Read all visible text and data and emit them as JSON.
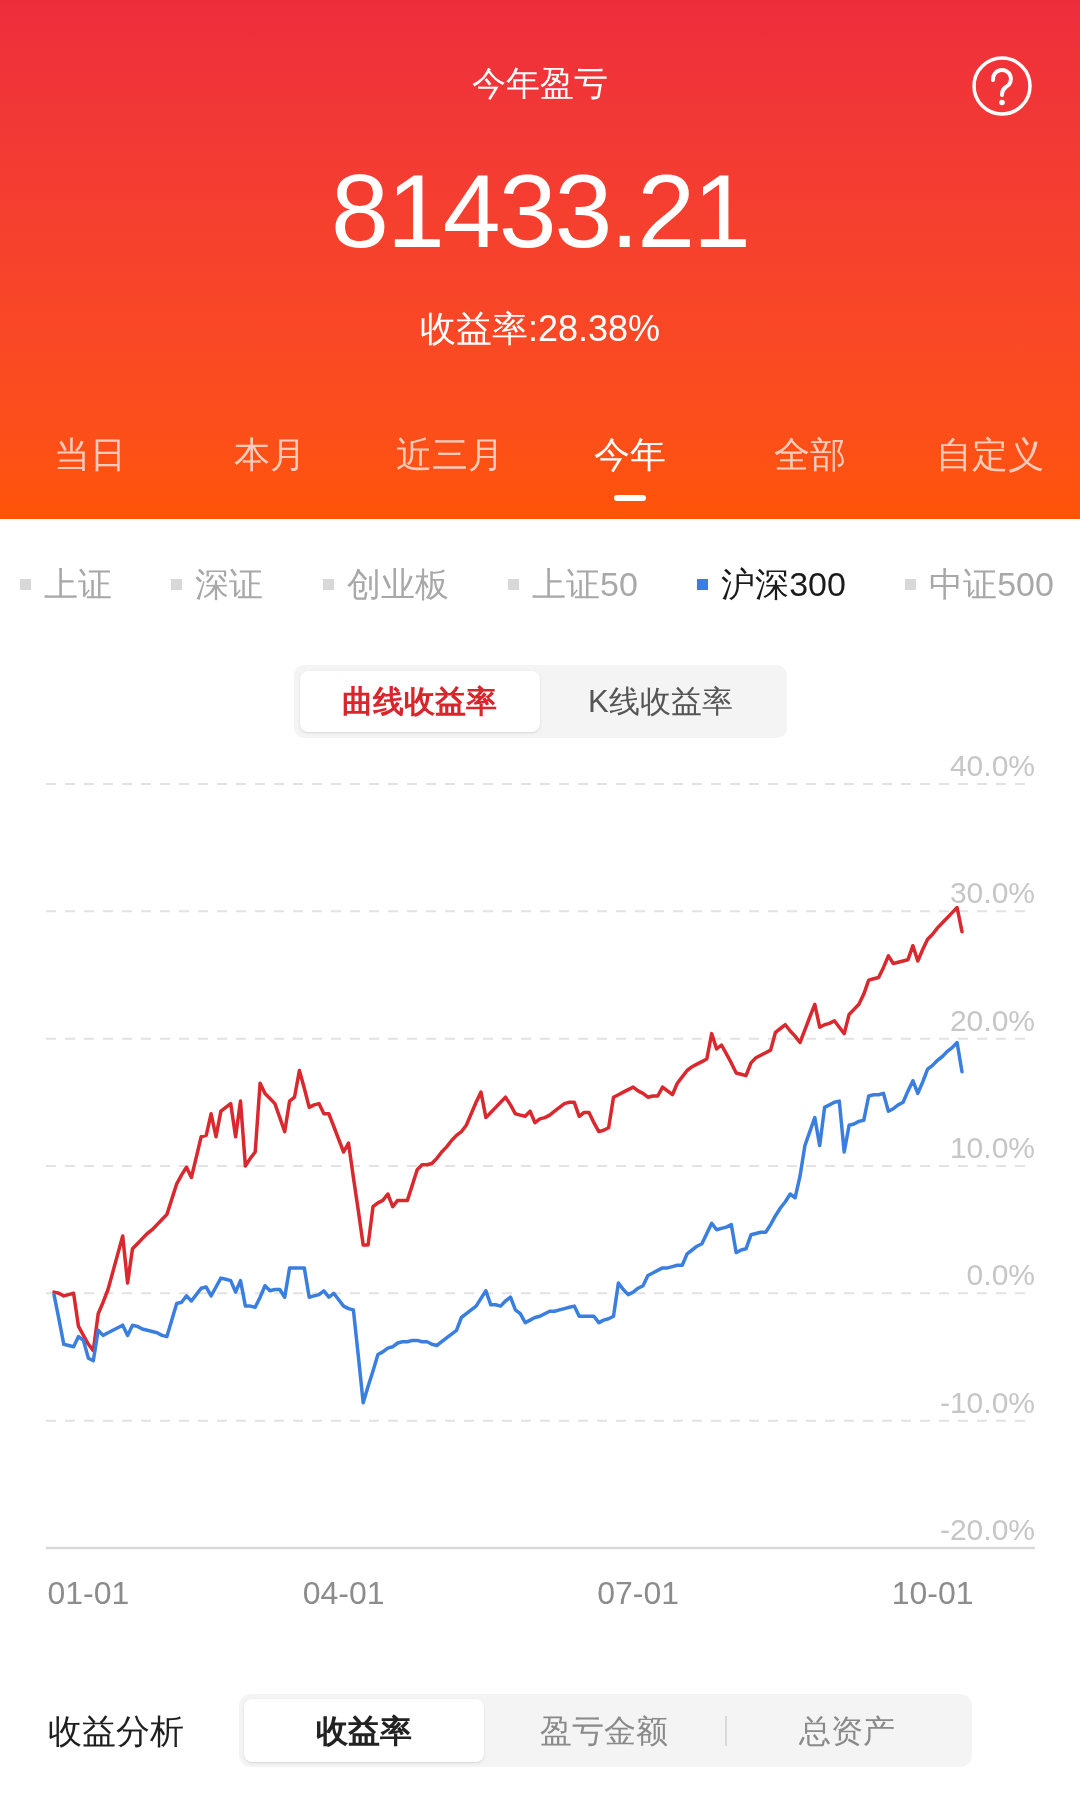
{
  "header": {
    "title": "今年盈亏",
    "amount": "81433.21",
    "return_rate": "收益率:28.38%"
  },
  "period_tabs": [
    {
      "label": "当日",
      "selected": false
    },
    {
      "label": "本月",
      "selected": false
    },
    {
      "label": "近三月",
      "selected": false
    },
    {
      "label": "今年",
      "selected": true
    },
    {
      "label": "全部",
      "selected": false
    },
    {
      "label": "自定义",
      "selected": false
    }
  ],
  "index_legend": [
    {
      "label": "上证",
      "selected": false
    },
    {
      "label": "深证",
      "selected": false
    },
    {
      "label": "创业板",
      "selected": false
    },
    {
      "label": "上证50",
      "selected": false
    },
    {
      "label": "沪深300",
      "selected": true
    },
    {
      "label": "中证500",
      "selected": false
    }
  ],
  "chart_mode_tabs": [
    {
      "label": "曲线收益率",
      "selected": true
    },
    {
      "label": "K线收益率",
      "selected": false
    }
  ],
  "chart": {
    "chart_data": {
      "type": "line",
      "grid": true,
      "ylim": [
        -20,
        40
      ],
      "categories": [
        null,
        null,
        null,
        null,
        null,
        null,
        null,
        "01-01",
        null,
        null,
        null,
        null,
        null,
        null,
        null,
        null,
        null,
        null,
        null,
        null,
        null,
        null,
        null,
        null,
        null,
        null,
        null,
        null,
        null,
        null,
        null,
        null,
        null,
        null,
        null,
        null,
        null,
        null,
        null,
        null,
        null,
        null,
        null,
        null,
        null,
        null,
        null,
        null,
        null,
        null,
        null,
        null,
        null,
        null,
        null,
        null,
        null,
        null,
        null,
        "04-01",
        null,
        null,
        null,
        null,
        null,
        null,
        null,
        null,
        null,
        null,
        null,
        null,
        null,
        null,
        null,
        null,
        null,
        null,
        null,
        null,
        null,
        null,
        null,
        null,
        null,
        null,
        null,
        null,
        null,
        null,
        null,
        null,
        null,
        null,
        null,
        null,
        null,
        null,
        null,
        null,
        null,
        null,
        null,
        null,
        null,
        null,
        null,
        null,
        null,
        null,
        null,
        null,
        null,
        null,
        null,
        null,
        null,
        null,
        null,
        "07-01",
        null,
        null,
        null,
        null,
        null,
        null,
        null,
        null,
        null,
        null,
        null,
        null,
        null,
        null,
        null,
        null,
        null,
        null,
        null,
        null,
        null,
        null,
        null,
        null,
        null,
        null,
        null,
        null,
        null,
        null,
        null,
        null,
        null,
        null,
        null,
        null,
        null,
        null,
        null,
        null,
        null,
        null,
        null,
        null,
        null,
        null,
        null,
        null,
        null,
        null,
        null,
        null,
        null,
        null,
        null,
        null,
        null,
        null,
        null,
        "10-01",
        null,
        null,
        null,
        null,
        null,
        null
      ],
      "yticks": [
        {
          "value": 40,
          "label": "40.0%"
        },
        {
          "value": 30,
          "label": "30.0%"
        },
        {
          "value": 20,
          "label": "20.0%"
        },
        {
          "value": 10,
          "label": "10.0%"
        },
        {
          "value": 0,
          "label": "0.0%"
        },
        {
          "value": -10,
          "label": "-10.0%"
        },
        {
          "value": -20,
          "label": "-20.0%"
        }
      ],
      "series": [
        {
          "color": "#d9282e",
          "values": [
            0.1,
            0.0,
            -0.2,
            -0.1,
            0.0,
            -2.6,
            -3.3,
            -4.0,
            -4.5,
            -1.6,
            -0.7,
            0.3,
            1.7,
            3.1,
            4.5,
            0.8,
            3.5,
            3.9,
            4.3,
            4.7,
            5.0,
            5.4,
            5.8,
            6.2,
            7.4,
            8.6,
            9.3,
            9.9,
            9.1,
            10.7,
            12.3,
            12.4,
            14.1,
            12.3,
            14.3,
            14.6,
            14.9,
            12.3,
            15.1,
            10.0,
            10.6,
            11.1,
            16.5,
            15.7,
            15.3,
            14.9,
            13.8,
            12.7,
            15.1,
            15.4,
            17.5,
            16.1,
            14.6,
            14.8,
            14.9,
            14.1,
            14.1,
            13.1,
            12.1,
            11.1,
            11.8,
            9.1,
            6.5,
            3.8,
            3.8,
            6.8,
            7.1,
            7.3,
            7.8,
            6.8,
            7.3,
            7.3,
            7.3,
            8.5,
            9.7,
            10.1,
            10.1,
            10.2,
            10.6,
            11.1,
            11.5,
            12.0,
            12.4,
            12.7,
            13.2,
            14.1,
            15.0,
            15.8,
            13.8,
            14.2,
            14.6,
            15.0,
            15.4,
            14.8,
            14.1,
            14.0,
            13.9,
            14.3,
            13.4,
            13.7,
            13.8,
            14.0,
            14.3,
            14.6,
            14.9,
            15.0,
            15.0,
            13.9,
            14.2,
            14.2,
            13.4,
            12.7,
            12.8,
            13.0,
            15.4,
            15.6,
            15.8,
            16.0,
            16.2,
            15.9,
            15.7,
            15.4,
            15.5,
            15.5,
            16.2,
            15.9,
            15.6,
            16.5,
            17.0,
            17.5,
            17.8,
            18.0,
            18.2,
            18.4,
            20.4,
            19.2,
            19.5,
            18.8,
            18.1,
            17.3,
            17.2,
            17.1,
            18.1,
            18.5,
            18.7,
            18.9,
            19.1,
            20.5,
            20.8,
            21.1,
            20.6,
            20.2,
            19.7,
            20.7,
            21.7,
            22.7,
            20.9,
            21.1,
            21.2,
            21.4,
            20.9,
            20.4,
            21.9,
            22.3,
            22.7,
            23.5,
            24.6,
            24.7,
            24.8,
            25.6,
            26.5,
            25.9,
            26.0,
            26.1,
            26.2,
            27.3,
            26.1,
            27.0,
            27.8,
            28.2,
            28.7,
            29.1,
            29.5,
            29.9,
            30.3,
            28.4
          ]
        },
        {
          "color": "#3a7fe0",
          "values": [
            -0.1,
            -2.0,
            -4.0,
            -4.1,
            -4.2,
            -3.4,
            -3.7,
            -5.1,
            -5.3,
            -2.9,
            -3.3,
            -3.1,
            -2.9,
            -2.7,
            -2.5,
            -3.3,
            -2.5,
            -2.6,
            -2.8,
            -2.9,
            -3.0,
            -3.1,
            -3.3,
            -3.4,
            -2.1,
            -0.8,
            -0.7,
            -0.2,
            -0.6,
            -0.1,
            0.4,
            0.5,
            -0.2,
            0.5,
            1.2,
            1.1,
            1.0,
            0.1,
            1.0,
            -1.0,
            -1.0,
            -1.1,
            -0.3,
            0.6,
            0.2,
            0.3,
            0.3,
            -0.3,
            2.0,
            2.0,
            2.0,
            2.0,
            -0.3,
            -0.2,
            -0.1,
            0.2,
            -0.3,
            0.0,
            -0.5,
            -1.0,
            -1.2,
            -1.3,
            -4.9,
            -8.6,
            -7.3,
            -6.1,
            -4.8,
            -4.6,
            -4.3,
            -4.2,
            -3.9,
            -3.8,
            -3.8,
            -3.7,
            -3.7,
            -3.8,
            -3.8,
            -4.0,
            -4.1,
            -3.8,
            -3.5,
            -3.2,
            -2.9,
            -1.9,
            -1.6,
            -1.3,
            -1.0,
            -0.4,
            0.2,
            -0.9,
            -0.9,
            -1.0,
            -0.6,
            -0.3,
            -1.3,
            -1.6,
            -2.3,
            -2.1,
            -1.9,
            -1.8,
            -1.6,
            -1.4,
            -1.4,
            -1.3,
            -1.2,
            -1.1,
            -1.0,
            -1.8,
            -1.8,
            -1.8,
            -1.8,
            -2.3,
            -2.1,
            -2.0,
            -1.8,
            0.8,
            0.3,
            -0.1,
            0.1,
            0.4,
            0.6,
            1.4,
            1.6,
            1.8,
            2.0,
            2.0,
            2.1,
            2.2,
            2.2,
            3.1,
            3.4,
            3.7,
            3.9,
            4.7,
            5.5,
            5.0,
            5.1,
            5.2,
            5.4,
            3.2,
            3.4,
            3.5,
            4.6,
            4.7,
            4.8,
            4.8,
            5.4,
            6.1,
            6.7,
            7.2,
            7.8,
            7.5,
            9.2,
            11.6,
            12.7,
            13.8,
            11.6,
            14.6,
            14.8,
            15.0,
            15.1,
            11.1,
            13.2,
            13.3,
            13.5,
            13.6,
            15.5,
            15.6,
            15.6,
            15.7,
            14.3,
            14.5,
            14.8,
            15.0,
            15.9,
            16.7,
            15.7,
            16.6,
            17.6,
            17.9,
            18.3,
            18.6,
            19.0,
            19.3,
            19.7,
            17.4
          ]
        }
      ]
    }
  },
  "analysis": {
    "title": "收益分析",
    "tabs": [
      {
        "label": "收益率",
        "selected": true
      },
      {
        "label": "盈亏金额",
        "selected": false
      },
      {
        "label": "总资产",
        "selected": false
      }
    ]
  }
}
